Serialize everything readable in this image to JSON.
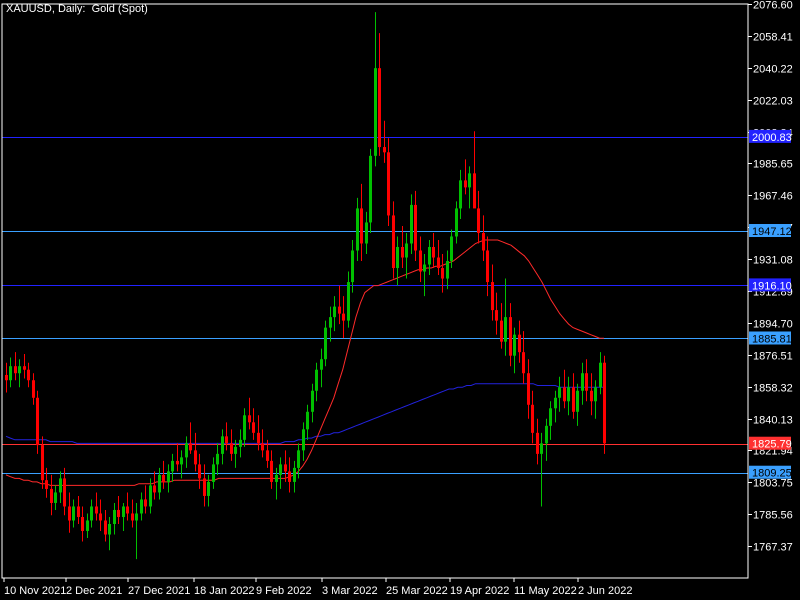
{
  "symbol_title": "XAUUSD, Daily:  Gold (Spot)",
  "colors": {
    "background": "#000000",
    "axis": "#ffffff",
    "bull_candle": "#00c000",
    "bear_candle": "#ff0000",
    "ma_fast": "#ff2a2a",
    "ma_slow": "#2222dd",
    "level_dark": "#2222ff",
    "level_light": "#3aa0ff",
    "current_line": "#ff3030"
  },
  "chart_data": {
    "type": "candlestick",
    "y_ticks": [
      "2076.60",
      "2058.41",
      "2040.22",
      "2022.03",
      "2003.84",
      "1985.65",
      "1967.46",
      "1949.27",
      "1931.08",
      "1912.89",
      "1894.70",
      "1876.51",
      "1858.32",
      "1840.13",
      "1821.94",
      "1803.75",
      "1785.56",
      "1767.37"
    ],
    "y_range": [
      1749.2,
      2076.6
    ],
    "x_tick_labels": [
      "10 Nov 2021",
      "2 Dec 2021",
      "27 Dec 2021",
      "18 Jan 2022",
      "9 Feb 2022",
      "3 Mar 2022",
      "25 Mar 2022",
      "19 Apr 2022",
      "11 May 2022",
      "2 Jun 2022"
    ],
    "horizontal_levels": [
      {
        "value": 2000.8,
        "color": "#2222ff",
        "label": "2000.83"
      },
      {
        "value": 1947.12,
        "color": "#3aa0ff",
        "label": "1947.12"
      },
      {
        "value": 1916.1,
        "color": "#2222ff",
        "label": "1916.10"
      },
      {
        "value": 1885.81,
        "color": "#3aa0ff",
        "label": "1885.81"
      },
      {
        "value": 1809.25,
        "color": "#3aa0ff",
        "label": "1809.25"
      }
    ],
    "current_price": {
      "value": 1825.79,
      "label": "1825.79"
    },
    "candles_ohlc": [
      [
        1865,
        1872,
        1855,
        1862
      ],
      [
        1862,
        1875,
        1858,
        1870
      ],
      [
        1870,
        1878,
        1862,
        1866
      ],
      [
        1866,
        1874,
        1858,
        1870
      ],
      [
        1870,
        1877,
        1863,
        1868
      ],
      [
        1868,
        1872,
        1858,
        1862
      ],
      [
        1862,
        1866,
        1848,
        1852
      ],
      [
        1852,
        1856,
        1820,
        1825
      ],
      [
        1825,
        1830,
        1800,
        1805
      ],
      [
        1805,
        1812,
        1795,
        1800
      ],
      [
        1800,
        1808,
        1785,
        1792
      ],
      [
        1792,
        1802,
        1788,
        1798
      ],
      [
        1798,
        1810,
        1792,
        1806
      ],
      [
        1806,
        1812,
        1785,
        1790
      ],
      [
        1790,
        1798,
        1775,
        1782
      ],
      [
        1782,
        1794,
        1778,
        1790
      ],
      [
        1790,
        1796,
        1780,
        1784
      ],
      [
        1784,
        1790,
        1770,
        1776
      ],
      [
        1776,
        1786,
        1772,
        1782
      ],
      [
        1782,
        1794,
        1778,
        1790
      ],
      [
        1790,
        1798,
        1782,
        1786
      ],
      [
        1786,
        1794,
        1776,
        1782
      ],
      [
        1782,
        1788,
        1770,
        1774
      ],
      [
        1774,
        1784,
        1765,
        1780
      ],
      [
        1780,
        1792,
        1774,
        1788
      ],
      [
        1788,
        1796,
        1780,
        1784
      ],
      [
        1784,
        1792,
        1776,
        1790
      ],
      [
        1790,
        1798,
        1782,
        1786
      ],
      [
        1786,
        1794,
        1778,
        1782
      ],
      [
        1782,
        1792,
        1760,
        1786
      ],
      [
        1786,
        1798,
        1782,
        1794
      ],
      [
        1794,
        1802,
        1786,
        1790
      ],
      [
        1790,
        1806,
        1786,
        1802
      ],
      [
        1802,
        1810,
        1794,
        1798
      ],
      [
        1798,
        1812,
        1794,
        1808
      ],
      [
        1808,
        1816,
        1800,
        1804
      ],
      [
        1804,
        1814,
        1798,
        1810
      ],
      [
        1810,
        1820,
        1804,
        1816
      ],
      [
        1816,
        1826,
        1810,
        1814
      ],
      [
        1814,
        1822,
        1806,
        1818
      ],
      [
        1818,
        1830,
        1812,
        1826
      ],
      [
        1826,
        1838,
        1820,
        1822
      ],
      [
        1822,
        1832,
        1810,
        1814
      ],
      [
        1814,
        1820,
        1800,
        1806
      ],
      [
        1806,
        1814,
        1790,
        1796
      ],
      [
        1796,
        1808,
        1790,
        1804
      ],
      [
        1804,
        1818,
        1800,
        1814
      ],
      [
        1814,
        1826,
        1808,
        1820
      ],
      [
        1820,
        1834,
        1814,
        1830
      ],
      [
        1830,
        1838,
        1822,
        1826
      ],
      [
        1826,
        1834,
        1816,
        1820
      ],
      [
        1820,
        1828,
        1812,
        1824
      ],
      [
        1824,
        1834,
        1818,
        1828
      ],
      [
        1828,
        1846,
        1824,
        1842
      ],
      [
        1842,
        1852,
        1834,
        1838
      ],
      [
        1838,
        1846,
        1828,
        1832
      ],
      [
        1832,
        1842,
        1822,
        1826
      ],
      [
        1826,
        1834,
        1818,
        1822
      ],
      [
        1822,
        1828,
        1812,
        1816
      ],
      [
        1816,
        1822,
        1800,
        1804
      ],
      [
        1804,
        1812,
        1794,
        1808
      ],
      [
        1808,
        1818,
        1800,
        1814
      ],
      [
        1814,
        1822,
        1804,
        1810
      ],
      [
        1810,
        1818,
        1798,
        1804
      ],
      [
        1804,
        1816,
        1798,
        1812
      ],
      [
        1812,
        1826,
        1806,
        1822
      ],
      [
        1822,
        1838,
        1816,
        1834
      ],
      [
        1834,
        1848,
        1828,
        1844
      ],
      [
        1844,
        1860,
        1838,
        1856
      ],
      [
        1856,
        1872,
        1850,
        1868
      ],
      [
        1868,
        1880,
        1858,
        1874
      ],
      [
        1874,
        1896,
        1870,
        1892
      ],
      [
        1892,
        1904,
        1884,
        1898
      ],
      [
        1898,
        1910,
        1890,
        1904
      ],
      [
        1904,
        1916,
        1894,
        1900
      ],
      [
        1900,
        1910,
        1886,
        1896
      ],
      [
        1896,
        1924,
        1892,
        1918
      ],
      [
        1918,
        1942,
        1912,
        1936
      ],
      [
        1936,
        1966,
        1930,
        1960
      ],
      [
        1960,
        1974,
        1930,
        1940
      ],
      [
        1940,
        1958,
        1934,
        1952
      ],
      [
        1952,
        1994,
        1946,
        1990
      ],
      [
        1990,
        2072,
        1984,
        2040
      ],
      [
        2040,
        2060,
        1990,
        1995
      ],
      [
        1995,
        2010,
        1986,
        1992
      ],
      [
        1992,
        2000,
        1950,
        1956
      ],
      [
        1956,
        1964,
        1920,
        1926
      ],
      [
        1926,
        1944,
        1916,
        1938
      ],
      [
        1938,
        1950,
        1926,
        1932
      ],
      [
        1932,
        1946,
        1920,
        1940
      ],
      [
        1940,
        1968,
        1934,
        1962
      ],
      [
        1962,
        1970,
        1930,
        1936
      ],
      [
        1936,
        1944,
        1918,
        1924
      ],
      [
        1924,
        1934,
        1910,
        1928
      ],
      [
        1928,
        1942,
        1922,
        1938
      ],
      [
        1938,
        1946,
        1926,
        1932
      ],
      [
        1932,
        1942,
        1922,
        1926
      ],
      [
        1926,
        1934,
        1912,
        1920
      ],
      [
        1920,
        1936,
        1914,
        1930
      ],
      [
        1930,
        1948,
        1926,
        1944
      ],
      [
        1944,
        1964,
        1940,
        1960
      ],
      [
        1960,
        1982,
        1954,
        1976
      ],
      [
        1976,
        1988,
        1968,
        1972
      ],
      [
        1972,
        1984,
        1960,
        1980
      ],
      [
        1980,
        2004,
        1974,
        1960
      ],
      [
        1960,
        1970,
        1940,
        1946
      ],
      [
        1946,
        1956,
        1930,
        1936
      ],
      [
        1936,
        1944,
        1910,
        1918
      ],
      [
        1918,
        1928,
        1896,
        1902
      ],
      [
        1902,
        1912,
        1888,
        1896
      ],
      [
        1896,
        1906,
        1880,
        1884
      ],
      [
        1884,
        1920,
        1876,
        1898
      ],
      [
        1898,
        1906,
        1870,
        1876
      ],
      [
        1876,
        1892,
        1866,
        1888
      ],
      [
        1888,
        1896,
        1872,
        1878
      ],
      [
        1878,
        1890,
        1860,
        1866
      ],
      [
        1866,
        1874,
        1840,
        1848
      ],
      [
        1848,
        1856,
        1826,
        1832
      ],
      [
        1832,
        1840,
        1814,
        1820
      ],
      [
        1820,
        1832,
        1790,
        1826
      ],
      [
        1826,
        1840,
        1816,
        1836
      ],
      [
        1836,
        1850,
        1828,
        1846
      ],
      [
        1846,
        1856,
        1838,
        1852
      ],
      [
        1852,
        1864,
        1844,
        1858
      ],
      [
        1858,
        1868,
        1846,
        1850
      ],
      [
        1850,
        1864,
        1842,
        1858
      ],
      [
        1858,
        1866,
        1840,
        1844
      ],
      [
        1844,
        1860,
        1836,
        1856
      ],
      [
        1856,
        1872,
        1848,
        1866
      ],
      [
        1866,
        1874,
        1850,
        1856
      ],
      [
        1856,
        1866,
        1842,
        1850
      ],
      [
        1850,
        1862,
        1840,
        1858
      ],
      [
        1858,
        1878,
        1854,
        1872
      ],
      [
        1872,
        1876,
        1820,
        1826
      ]
    ],
    "ma_fast": [
      1808,
      1807,
      1806,
      1806,
      1805,
      1805,
      1804,
      1804,
      1803,
      1803,
      1802,
      1802,
      1802,
      1802,
      1802,
      1802,
      1802,
      1802,
      1802,
      1802,
      1802,
      1802,
      1802,
      1802,
      1802,
      1802,
      1802,
      1802,
      1802,
      1802,
      1803,
      1803,
      1803,
      1803,
      1804,
      1804,
      1804,
      1804,
      1805,
      1805,
      1805,
      1805,
      1805,
      1805,
      1805,
      1805,
      1805,
      1805,
      1806,
      1806,
      1806,
      1806,
      1806,
      1806,
      1806,
      1806,
      1806,
      1806,
      1806,
      1806,
      1806,
      1806,
      1806,
      1806,
      1807,
      1808,
      1810,
      1813,
      1817,
      1822,
      1828,
      1834,
      1840,
      1846,
      1852,
      1860,
      1868,
      1878,
      1888,
      1898,
      1906,
      1912,
      1914,
      1916,
      1916,
      1917,
      1918,
      1919,
      1920,
      1921,
      1922,
      1923,
      1924,
      1925,
      1925,
      1926,
      1926,
      1927,
      1927,
      1928,
      1929,
      1930,
      1932,
      1934,
      1936,
      1938,
      1940,
      1941,
      1942,
      1942,
      1942,
      1942,
      1941,
      1940,
      1939,
      1937,
      1935,
      1933,
      1930,
      1926,
      1922,
      1918,
      1913,
      1908,
      1904,
      1900,
      1897,
      1894,
      1892,
      1891,
      1890,
      1889,
      1888,
      1887,
      1886,
      1886
    ],
    "ma_slow": [
      1830,
      1829,
      1828,
      1828,
      1828,
      1828,
      1828,
      1828,
      1828,
      1828,
      1827,
      1827,
      1827,
      1827,
      1827,
      1827,
      1826,
      1826,
      1826,
      1826,
      1826,
      1826,
      1826,
      1826,
      1826,
      1826,
      1826,
      1826,
      1826,
      1826,
      1826,
      1826,
      1826,
      1826,
      1826,
      1826,
      1826,
      1826,
      1826,
      1826,
      1826,
      1826,
      1826,
      1826,
      1826,
      1826,
      1826,
      1826,
      1826,
      1826,
      1826,
      1826,
      1826,
      1826,
      1826,
      1826,
      1826,
      1826,
      1826,
      1826,
      1826,
      1826,
      1826,
      1827,
      1827,
      1827,
      1828,
      1828,
      1829,
      1829,
      1830,
      1830,
      1831,
      1831,
      1832,
      1832,
      1833,
      1834,
      1835,
      1836,
      1837,
      1838,
      1839,
      1840,
      1841,
      1842,
      1843,
      1844,
      1845,
      1846,
      1847,
      1848,
      1849,
      1850,
      1851,
      1852,
      1853,
      1854,
      1855,
      1856,
      1857,
      1857,
      1858,
      1858,
      1859,
      1859,
      1860,
      1860,
      1860,
      1860,
      1860,
      1860,
      1860,
      1860,
      1860,
      1860,
      1860,
      1860,
      1860,
      1860,
      1859,
      1859,
      1859,
      1859,
      1859,
      1858,
      1858,
      1858,
      1858,
      1858,
      1858,
      1858,
      1858,
      1858,
      1858,
      1858
    ]
  }
}
